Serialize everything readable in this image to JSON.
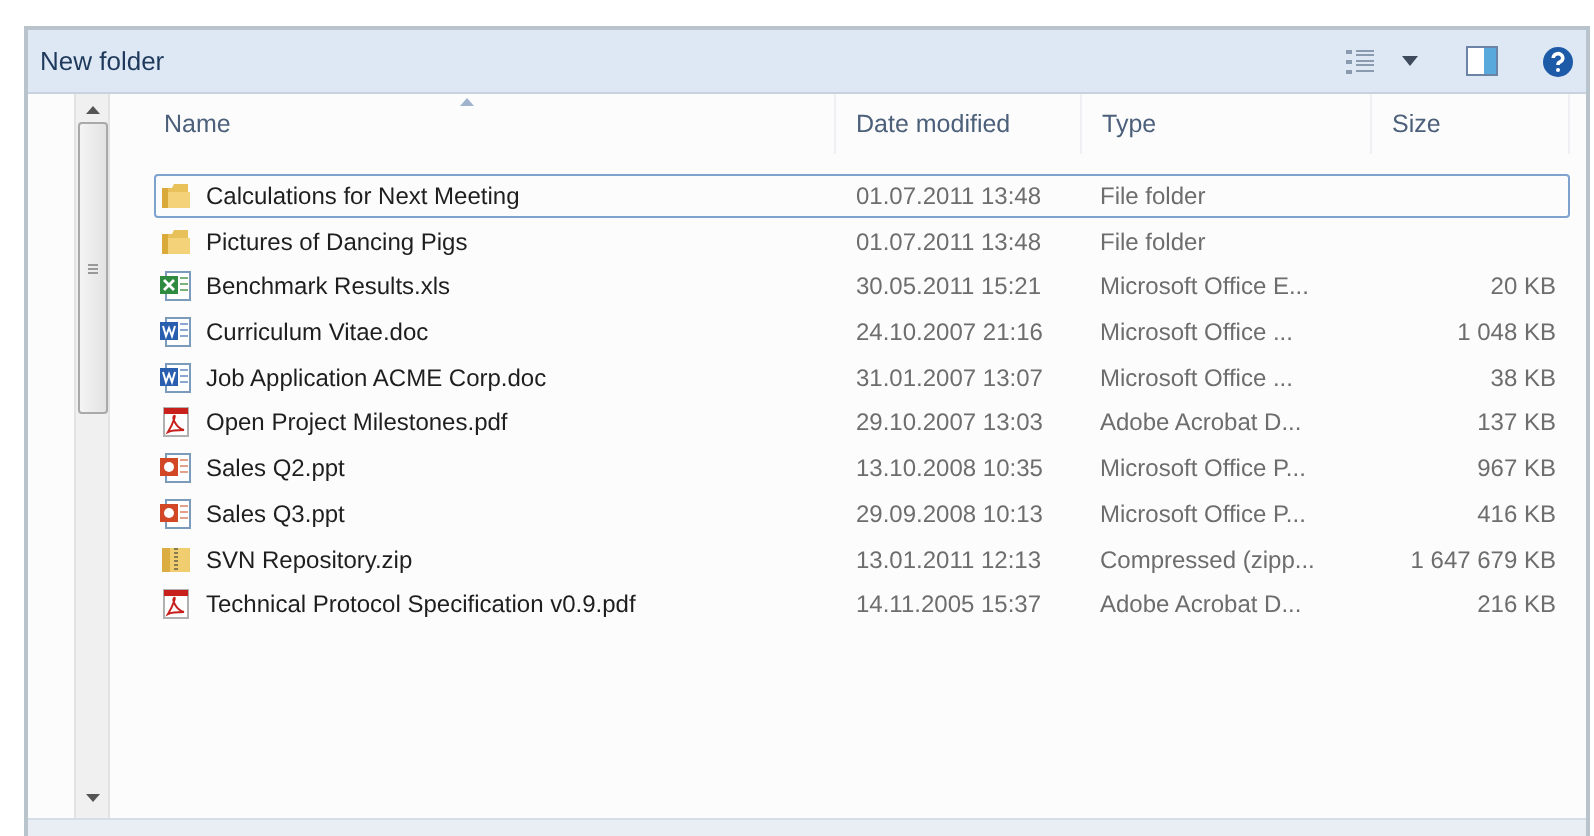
{
  "window": {
    "title": "New folder"
  },
  "table": {
    "columns": [
      {
        "label": "Name",
        "sorted": true
      },
      {
        "label": "Date modified",
        "sorted": false
      },
      {
        "label": "Type",
        "sorted": false
      },
      {
        "label": "Size",
        "sorted": false
      }
    ],
    "rows": [
      {
        "kind": "folder",
        "selected": true,
        "name": "Calculations for Next Meeting",
        "date": "01.07.2011 13:48",
        "type": "File folder"
      },
      {
        "kind": "folder",
        "selected": false,
        "name": "Pictures of Dancing Pigs",
        "date": "01.07.2011 13:48",
        "type": "File folder"
      },
      {
        "kind": "excel",
        "selected": false,
        "name": "Benchmark Results.xls",
        "date": "30.05.2011 15:21",
        "type": "Microsoft Office E...",
        "size": "20 KB"
      },
      {
        "kind": "word",
        "selected": false,
        "name": "Curriculum Vitae.doc",
        "date": "24.10.2007 21:16",
        "type": "Microsoft Office ...",
        "size": "1 048 KB"
      },
      {
        "kind": "word",
        "selected": false,
        "name": "Job Application ACME Corp.doc",
        "date": "31.01.2007 13:07",
        "type": "Microsoft Office ...",
        "size": "38 KB"
      },
      {
        "kind": "pdf",
        "selected": false,
        "name": "Open Project Milestones.pdf",
        "date": "29.10.2007 13:03",
        "type": "Adobe Acrobat D...",
        "size": "137 KB"
      },
      {
        "kind": "ppt",
        "selected": false,
        "name": "Sales Q2.ppt",
        "date": "13.10.2008 10:35",
        "type": "Microsoft Office P...",
        "size": "967 KB"
      },
      {
        "kind": "ppt",
        "selected": false,
        "name": "Sales Q3.ppt",
        "date": "29.09.2008 10:13",
        "type": "Microsoft Office P...",
        "size": "416 KB"
      },
      {
        "kind": "zip",
        "selected": false,
        "name": "SVN Repository.zip",
        "date": "13.01.2011 12:13",
        "type": "Compressed (zipp...",
        "size": "1 647 679 KB"
      },
      {
        "kind": "pdf",
        "selected": false,
        "name": "Technical Protocol Specification v0.9.pdf",
        "date": "14.11.2005 15:37",
        "type": "Adobe Acrobat D...",
        "size": "216 KB"
      }
    ]
  }
}
